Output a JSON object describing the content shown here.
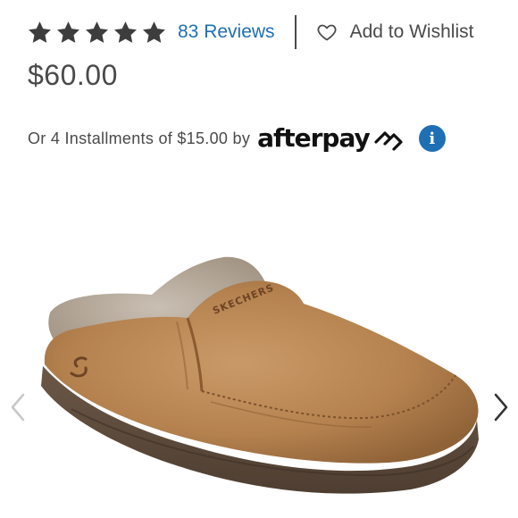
{
  "rating": {
    "stars": 5,
    "review_link": "83 Reviews"
  },
  "wishlist": {
    "label": "Add to Wishlist",
    "icon": "heart-outline-icon"
  },
  "price": "$60.00",
  "installments": {
    "text": "Or 4 Installments of $15.00 by",
    "provider_logo": "afterpay",
    "info_icon": "info-icon"
  },
  "product_image": {
    "brand_mark": "SKECHERS",
    "icons": [
      "chevron-left-icon",
      "chevron-right-icon"
    ]
  },
  "colors": {
    "link_blue": "#1f6fb5",
    "text_gray": "#4a4a4a",
    "star_gray": "#3d3d3d"
  }
}
